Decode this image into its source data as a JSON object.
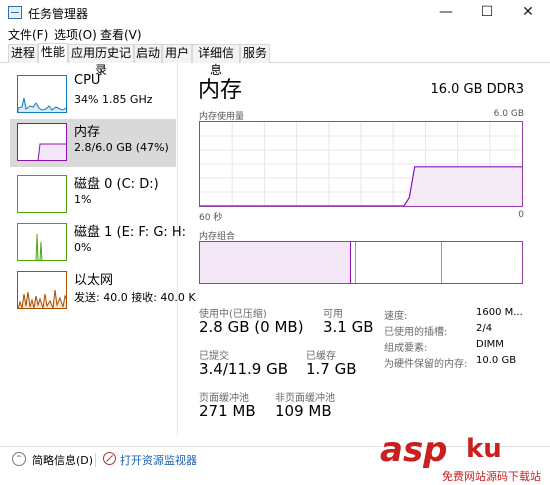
{
  "window": {
    "title": "任务管理器",
    "controls": {
      "minimize": "—",
      "maximize": "☐",
      "close": "✕"
    }
  },
  "menu": [
    "文件(F)",
    "选项(O)",
    "查看(V)"
  ],
  "tabs": [
    "进程",
    "性能",
    "应用历史记录",
    "启动",
    "用户",
    "详细信息",
    "服务"
  ],
  "active_tab": "性能",
  "sidebar": [
    {
      "name": "CPU",
      "detail": "34%  1.85 GHz",
      "color": "#117dbb"
    },
    {
      "name": "内存",
      "detail": "2.8/6.0 GB (47%)",
      "color": "#8b12ae"
    },
    {
      "name": "磁盘 0 (C: D:)",
      "detail": "1%",
      "color": "#4da60c"
    },
    {
      "name": "磁盘 1 (E: F: G: H:",
      "detail": "0%",
      "color": "#4da60c"
    },
    {
      "name": "以太网",
      "detail": "发送: 40.0  接收: 40.0 K",
      "color": "#a74f01"
    }
  ],
  "memory": {
    "title": "内存",
    "spec": "16.0 GB DDR3",
    "usage_label": "内存使用量",
    "usage_max": "6.0 GB",
    "x_left": "60 秒",
    "x_right": "0",
    "composition_label": "内存组合",
    "stats": {
      "in_use_label": "使用中(已压缩)",
      "in_use": "2.8 GB (0 MB)",
      "available_label": "可用",
      "available": "3.1 GB",
      "committed_label": "已提交",
      "committed": "3.4/11.9 GB",
      "cached_label": "已缓存",
      "cached": "1.7 GB",
      "paged_label": "页面缓冲池",
      "paged": "271 MB",
      "nonpaged_label": "非页面缓冲池",
      "nonpaged": "109 MB"
    },
    "details": [
      {
        "key": "速度:",
        "value": "1600 M..."
      },
      {
        "key": "已使用的插槽:",
        "value": "2/4"
      },
      {
        "key": "组成要素:",
        "value": "DIMM"
      },
      {
        "key": "为硬件保留的内存:",
        "value": "10.0 GB"
      }
    ],
    "accent": "#8b12ae"
  },
  "chart_data": {
    "type": "area",
    "title": "内存使用量",
    "x_range": [
      60,
      0
    ],
    "ylim": [
      0,
      6.0
    ],
    "x": [
      60,
      59,
      58,
      57,
      56,
      55,
      54,
      53,
      52,
      51,
      50,
      49,
      48,
      47,
      46,
      45,
      44,
      43,
      42,
      41,
      40,
      39,
      38,
      37,
      36,
      35,
      34,
      33,
      32,
      31,
      30,
      29,
      28,
      27,
      26,
      25,
      24,
      23,
      22,
      21,
      20,
      19,
      18,
      17,
      16,
      15,
      14,
      13,
      12,
      11,
      10,
      9,
      8,
      7,
      6,
      5,
      4,
      3,
      2,
      1,
      0
    ],
    "series": [
      {
        "values": [
          0,
          0,
          0,
          0,
          0,
          0,
          0,
          0,
          0,
          0,
          0,
          0,
          0,
          0,
          0,
          0,
          0,
          0,
          0,
          0,
          0,
          0,
          0,
          0,
          0,
          0,
          0,
          0,
          0,
          0,
          0,
          0,
          0,
          0,
          0,
          0,
          0,
          0,
          0,
          0.6,
          2.8,
          2.8,
          2.8,
          2.8,
          2.8,
          2.8,
          2.8,
          2.8,
          2.8,
          2.8,
          2.8,
          2.8,
          2.8,
          2.8,
          2.8,
          2.8,
          2.8,
          2.8,
          2.8,
          2.8,
          2.8
        ]
      }
    ],
    "grid": true
  },
  "footer": {
    "fewer_details": "简略信息(D)",
    "open_resmon": "打开资源监视器"
  },
  "watermark": {
    "brand": "asp",
    "brand_cn": "ku",
    "site": "免费网站源码下载站"
  }
}
